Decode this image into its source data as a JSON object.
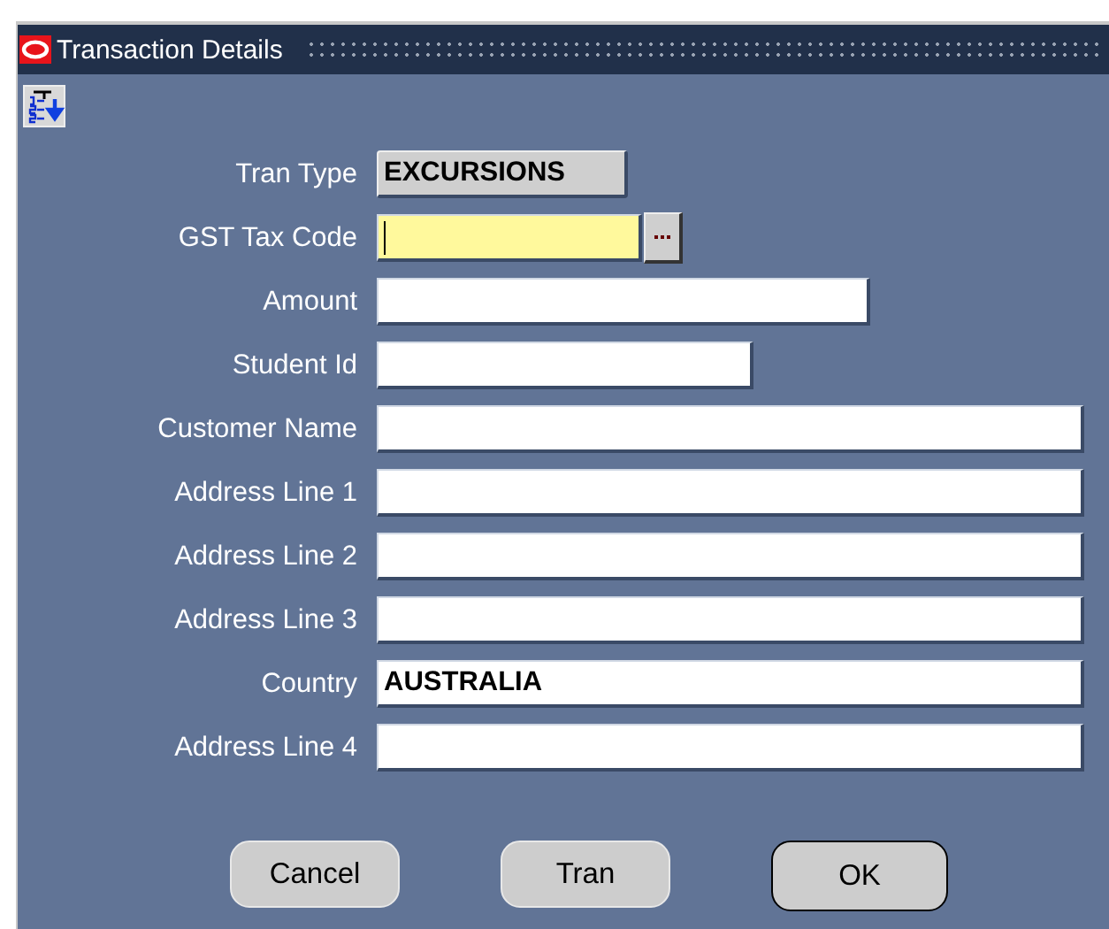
{
  "window": {
    "title": "Transaction Details"
  },
  "fields": [
    {
      "label": "Tran Type",
      "kind": "display",
      "value": "EXCURSIONS",
      "focused": false
    },
    {
      "label": "GST Tax Code",
      "kind": "lov",
      "focused": true
    },
    {
      "label": "Amount",
      "kind": "text",
      "focused": false
    },
    {
      "label": "Student Id",
      "kind": "text",
      "focused": false
    },
    {
      "label": "Customer Name",
      "kind": "text",
      "focused": false
    },
    {
      "label": "Address Line 1",
      "kind": "text",
      "focused": false
    },
    {
      "label": "Address Line 2",
      "kind": "text",
      "focused": false
    },
    {
      "label": "Address Line 3",
      "kind": "text",
      "focused": false
    },
    {
      "label": "Country",
      "kind": "text",
      "value": "AUSTRALIA",
      "focused": false
    },
    {
      "label": "Address Line 4",
      "kind": "text",
      "focused": false
    }
  ],
  "buttons": [
    {
      "label": "Cancel",
      "default": false
    },
    {
      "label": "Tran",
      "default": false
    },
    {
      "label": "OK",
      "default": true
    }
  ]
}
